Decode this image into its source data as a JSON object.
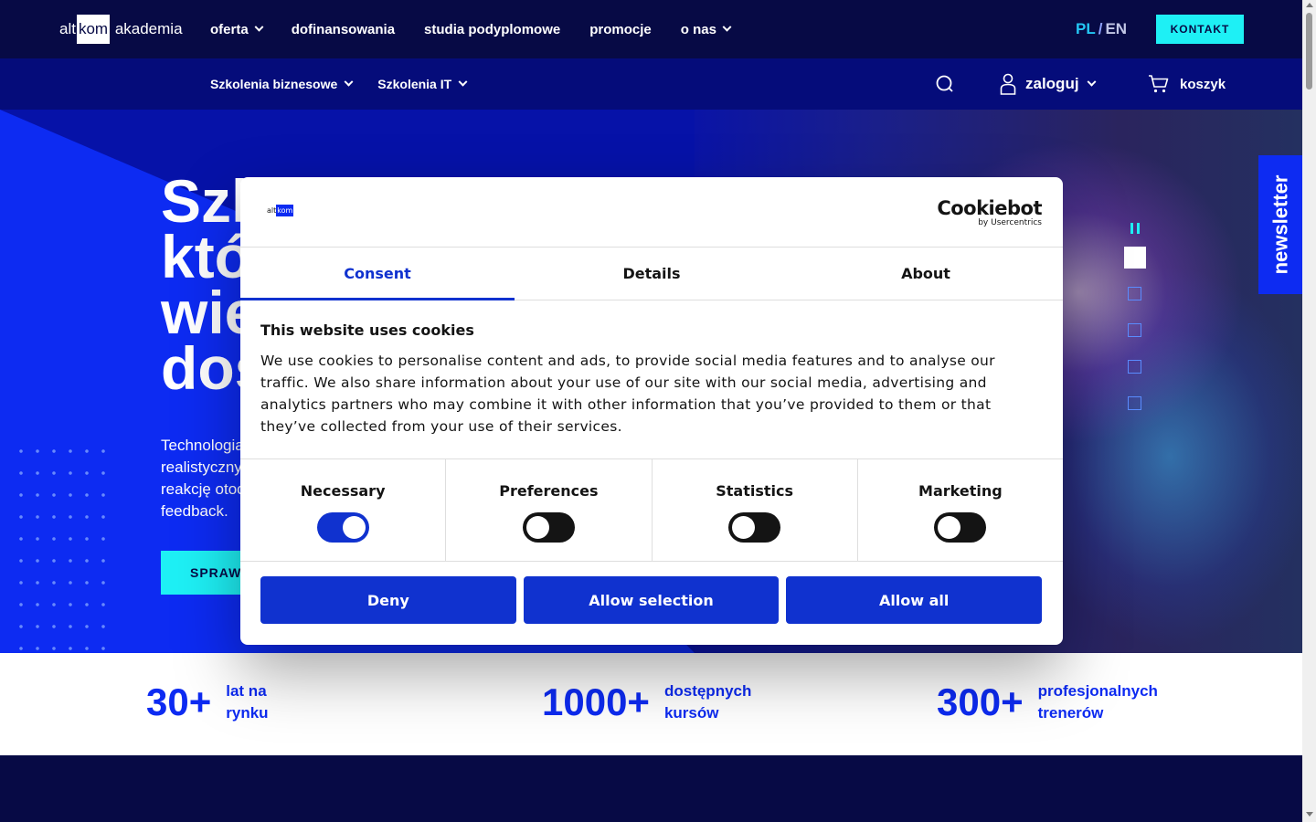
{
  "header": {
    "logo": {
      "prefix": "alt",
      "box": "kom",
      "suffix": " akademia"
    },
    "nav": [
      {
        "label": "oferta",
        "dropdown": true
      },
      {
        "label": "dofinansowania",
        "dropdown": false
      },
      {
        "label": "studia podyplomowe",
        "dropdown": false
      },
      {
        "label": "promocje",
        "dropdown": false
      },
      {
        "label": "o nas",
        "dropdown": true
      }
    ],
    "lang": {
      "pl": "PL",
      "sep": "/",
      "en": "EN",
      "active": "PL"
    },
    "contact_button": "KONTAKT"
  },
  "subheader": {
    "nav": [
      {
        "label": "Szkolenia biznesowe"
      },
      {
        "label": "Szkolenia IT"
      }
    ],
    "search_icon": "search-icon",
    "login_label": "zaloguj",
    "cart_label": "koszyk"
  },
  "hero": {
    "title_lines": [
      "Szk",
      "któ",
      "wie",
      "dos"
    ],
    "description_lines": [
      "Technologia",
      "realistyczny",
      "reakcję otoc",
      "feedback."
    ],
    "button_label": "SPRAW",
    "newsletter_label": "newsletter",
    "slides": {
      "count": 5,
      "active": 1
    }
  },
  "stats": [
    {
      "number": "30+",
      "label_lines": [
        "lat na",
        "rynku"
      ]
    },
    {
      "number": "1000+",
      "label_lines": [
        "dostępnych",
        "kursów"
      ]
    },
    {
      "number": "300+",
      "label_lines": [
        "profesjonalnych",
        "trenerów"
      ]
    }
  ],
  "cookie_dialog": {
    "brand_logo": {
      "prefix": "alt",
      "box": "kom"
    },
    "provider": {
      "main": "Cookiebot",
      "sub": "by Usercentrics"
    },
    "tabs": [
      {
        "label": "Consent",
        "active": true
      },
      {
        "label": "Details",
        "active": false
      },
      {
        "label": "About",
        "active": false
      }
    ],
    "heading": "This website uses cookies",
    "body": "We use cookies to personalise content and ads, to provide social media features and to analyse our traffic. We also share information about your use of our site with our social media, advertising and analytics partners who may combine it with other information that you’ve provided to them or that they’ve collected from your use of their services.",
    "categories": [
      {
        "label": "Necessary",
        "enabled": true
      },
      {
        "label": "Preferences",
        "enabled": false
      },
      {
        "label": "Statistics",
        "enabled": false
      },
      {
        "label": "Marketing",
        "enabled": false
      }
    ],
    "buttons": {
      "deny": "Deny",
      "allow_selection": "Allow selection",
      "allow_all": "Allow all"
    }
  },
  "colors": {
    "navy": "#070a45",
    "brand_blue": "#0d2bf2",
    "cyan": "#1ef0f5",
    "cookie_blue": "#1032cf"
  }
}
